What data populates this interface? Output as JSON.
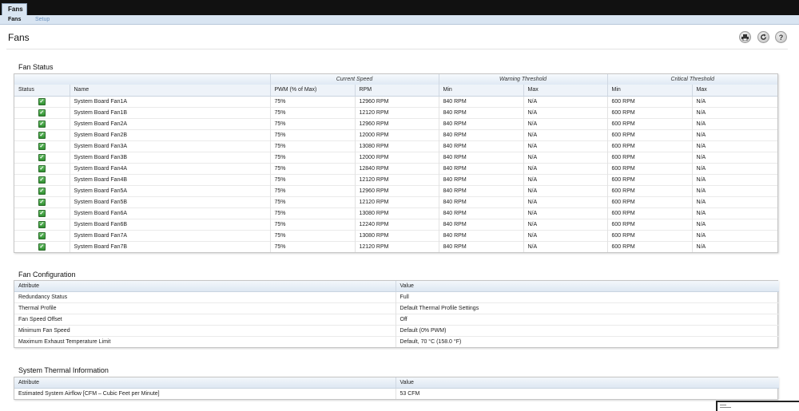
{
  "top_tab": "Fans",
  "subnav": {
    "active": "Fans",
    "inactive": "Setup"
  },
  "page_title": "Fans",
  "fan_status": {
    "title": "Fan Status",
    "groups": {
      "current_speed": "Current Speed",
      "warning": "Warning Threshold",
      "critical": "Critical Threshold"
    },
    "headers": {
      "status": "Status",
      "name": "Name",
      "pwm": "PWM (% of Max)",
      "rpm": "RPM",
      "warn_min": "Min",
      "warn_max": "Max",
      "crit_min": "Min",
      "crit_max": "Max"
    },
    "rows": [
      {
        "name": "System Board Fan1A",
        "pwm": "75%",
        "rpm": "12960 RPM",
        "warn_min": "840 RPM",
        "warn_max": "N/A",
        "crit_min": "600 RPM",
        "crit_max": "N/A"
      },
      {
        "name": "System Board Fan1B",
        "pwm": "75%",
        "rpm": "12120 RPM",
        "warn_min": "840 RPM",
        "warn_max": "N/A",
        "crit_min": "600 RPM",
        "crit_max": "N/A"
      },
      {
        "name": "System Board Fan2A",
        "pwm": "75%",
        "rpm": "12960 RPM",
        "warn_min": "840 RPM",
        "warn_max": "N/A",
        "crit_min": "600 RPM",
        "crit_max": "N/A"
      },
      {
        "name": "System Board Fan2B",
        "pwm": "75%",
        "rpm": "12000 RPM",
        "warn_min": "840 RPM",
        "warn_max": "N/A",
        "crit_min": "600 RPM",
        "crit_max": "N/A"
      },
      {
        "name": "System Board Fan3A",
        "pwm": "75%",
        "rpm": "13080 RPM",
        "warn_min": "840 RPM",
        "warn_max": "N/A",
        "crit_min": "600 RPM",
        "crit_max": "N/A"
      },
      {
        "name": "System Board Fan3B",
        "pwm": "75%",
        "rpm": "12000 RPM",
        "warn_min": "840 RPM",
        "warn_max": "N/A",
        "crit_min": "600 RPM",
        "crit_max": "N/A"
      },
      {
        "name": "System Board Fan4A",
        "pwm": "75%",
        "rpm": "12840 RPM",
        "warn_min": "840 RPM",
        "warn_max": "N/A",
        "crit_min": "600 RPM",
        "crit_max": "N/A"
      },
      {
        "name": "System Board Fan4B",
        "pwm": "75%",
        "rpm": "12120 RPM",
        "warn_min": "840 RPM",
        "warn_max": "N/A",
        "crit_min": "600 RPM",
        "crit_max": "N/A"
      },
      {
        "name": "System Board Fan5A",
        "pwm": "75%",
        "rpm": "12960 RPM",
        "warn_min": "840 RPM",
        "warn_max": "N/A",
        "crit_min": "600 RPM",
        "crit_max": "N/A"
      },
      {
        "name": "System Board Fan5B",
        "pwm": "75%",
        "rpm": "12120 RPM",
        "warn_min": "840 RPM",
        "warn_max": "N/A",
        "crit_min": "600 RPM",
        "crit_max": "N/A"
      },
      {
        "name": "System Board Fan6A",
        "pwm": "75%",
        "rpm": "13080 RPM",
        "warn_min": "840 RPM",
        "warn_max": "N/A",
        "crit_min": "600 RPM",
        "crit_max": "N/A"
      },
      {
        "name": "System Board Fan6B",
        "pwm": "75%",
        "rpm": "12240 RPM",
        "warn_min": "840 RPM",
        "warn_max": "N/A",
        "crit_min": "600 RPM",
        "crit_max": "N/A"
      },
      {
        "name": "System Board Fan7A",
        "pwm": "75%",
        "rpm": "13080 RPM",
        "warn_min": "840 RPM",
        "warn_max": "N/A",
        "crit_min": "600 RPM",
        "crit_max": "N/A"
      },
      {
        "name": "System Board Fan7B",
        "pwm": "75%",
        "rpm": "12120 RPM",
        "warn_min": "840 RPM",
        "warn_max": "N/A",
        "crit_min": "600 RPM",
        "crit_max": "N/A"
      }
    ]
  },
  "fan_config": {
    "title": "Fan Configuration",
    "headers": {
      "attribute": "Attribute",
      "value": "Value"
    },
    "rows": [
      {
        "attribute": "Redundancy Status",
        "value": "Full"
      },
      {
        "attribute": "Thermal Profile",
        "value": "Default Thermal Profile Settings"
      },
      {
        "attribute": "Fan Speed Offset",
        "value": "Off"
      },
      {
        "attribute": "Minimum Fan Speed",
        "value": "Default (0% PWM)"
      },
      {
        "attribute": "Maximum Exhaust Temperature Limit",
        "value": "Default, 70 °C (158.0 °F)"
      }
    ]
  },
  "thermal_info": {
    "title": "System Thermal Information",
    "headers": {
      "attribute": "Attribute",
      "value": "Value"
    },
    "rows": [
      {
        "attribute": "Estimated System Airflow [CFM – Cubic Feet per Minute]",
        "value": "53 CFM"
      }
    ]
  },
  "icons": {
    "print": "print-icon",
    "refresh": "refresh-icon",
    "help": "help-icon",
    "status_ok": "green-check-icon"
  }
}
